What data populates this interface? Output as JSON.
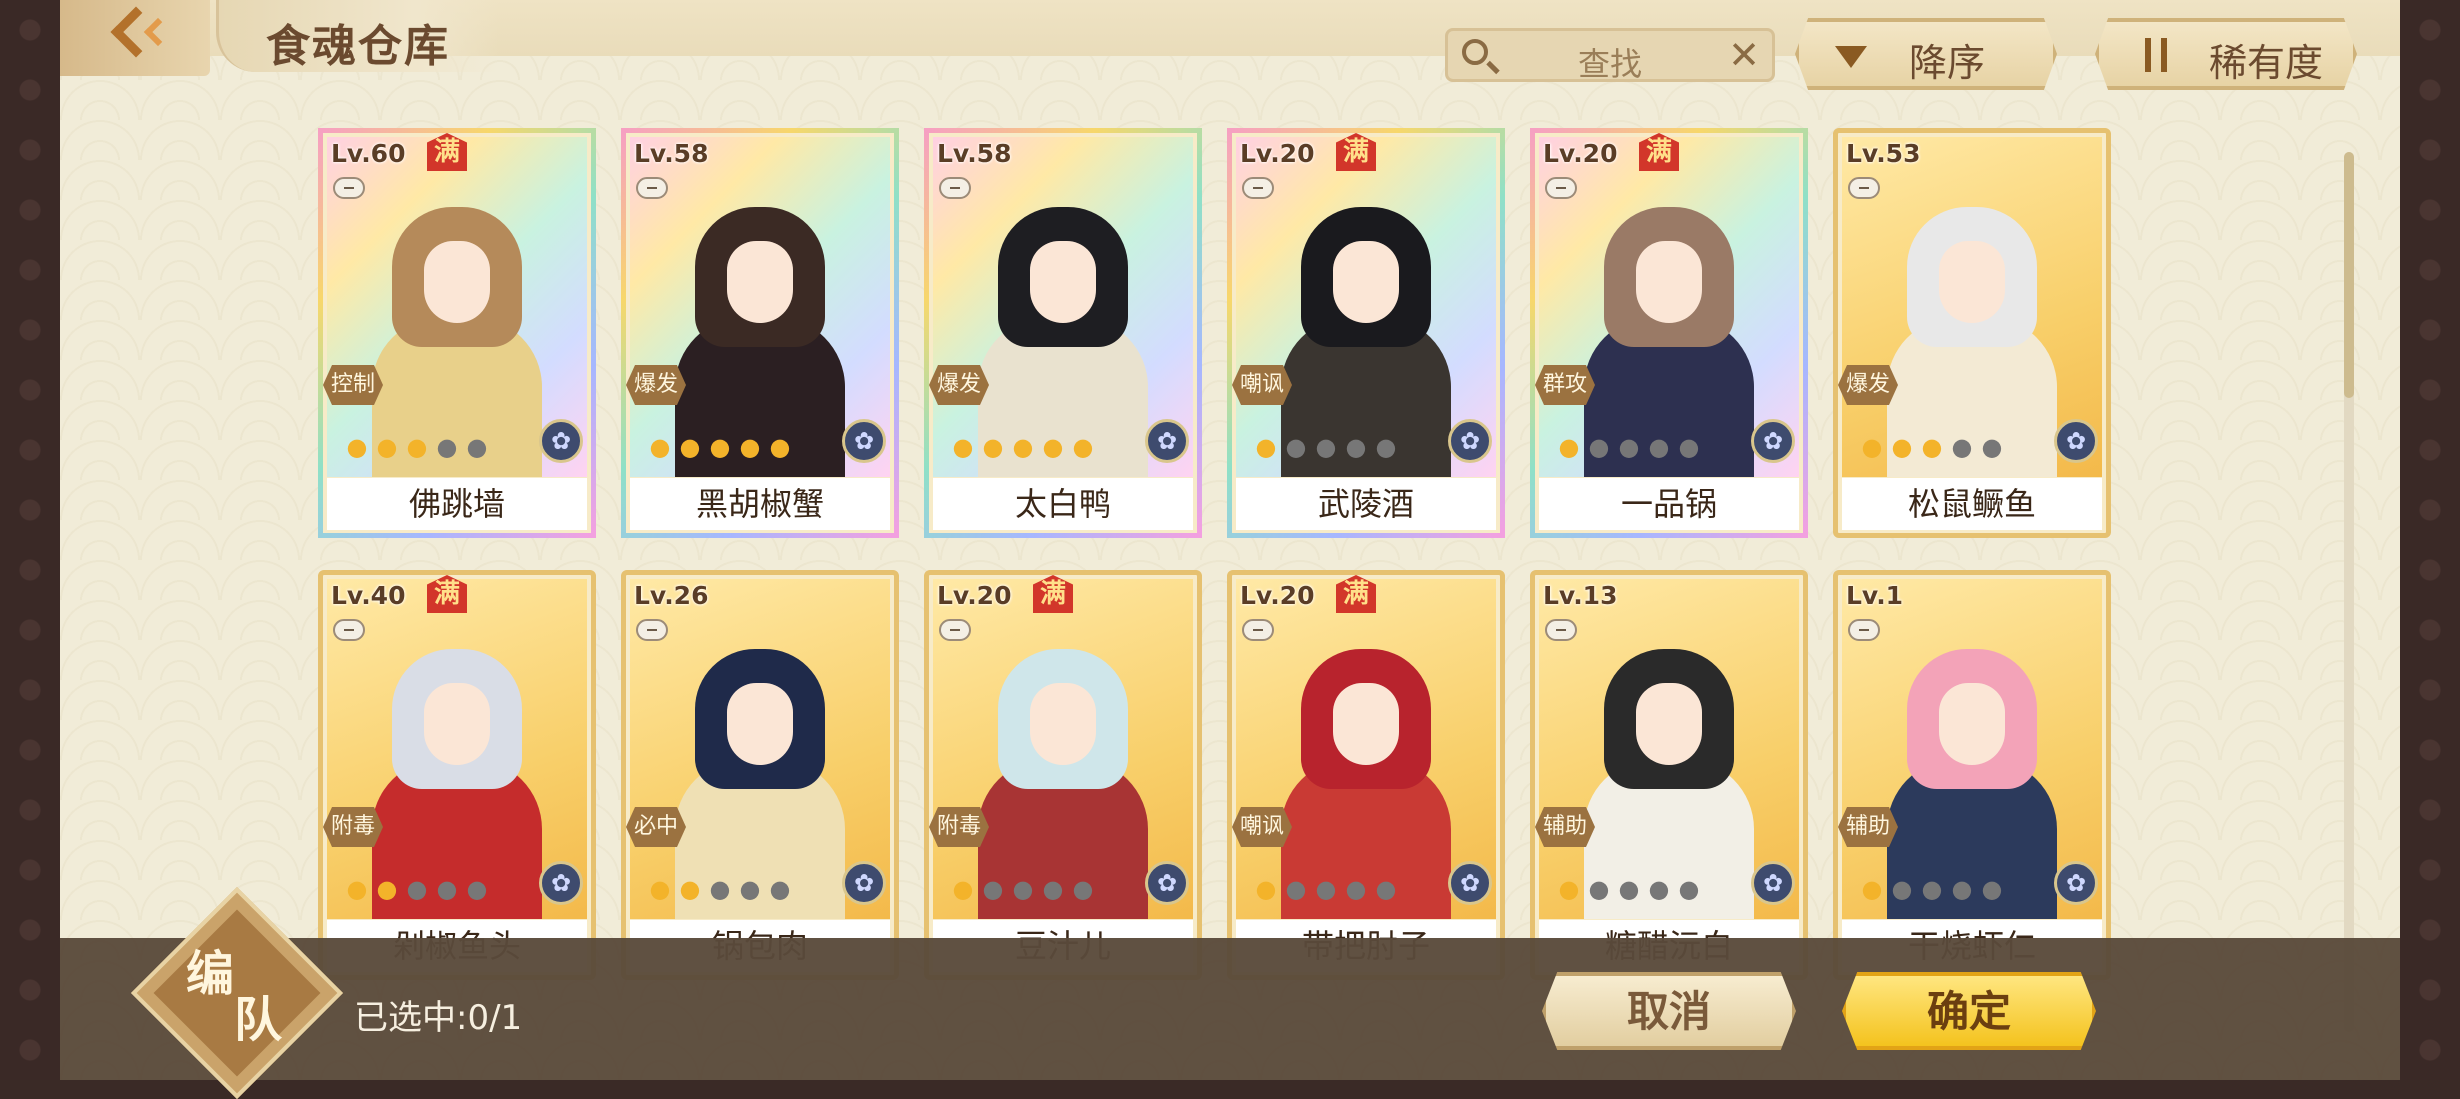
{
  "header": {
    "title": "食魂仓库",
    "search_placeholder": "查找",
    "sort_desc_label": "降序",
    "sort_rarity_label": "稀有度"
  },
  "colors": {
    "panel_bg": "#f1ecd8",
    "card_border_gold": "#e6c170",
    "confirm_yellow": "#f4c31e",
    "full_badge_red": "#d2362a"
  },
  "scroll": {
    "position_fraction": 0.0,
    "visible_fraction": 0.28
  },
  "cards": [
    {
      "level": "Lv.60",
      "full": "满",
      "role": "控制",
      "name": "佛跳墙",
      "stars": 3,
      "max_stars": 5,
      "frame": "rainbow",
      "hair": "#b58a5a",
      "body": "#e8d08a"
    },
    {
      "level": "Lv.58",
      "full": "",
      "role": "爆发",
      "name": "黑胡椒蟹",
      "stars": 5,
      "max_stars": 5,
      "frame": "rainbow",
      "hair": "#3b2a24",
      "body": "#2b1f22"
    },
    {
      "level": "Lv.58",
      "full": "",
      "role": "爆发",
      "name": "太白鸭",
      "stars": 5,
      "max_stars": 5,
      "frame": "rainbow",
      "hair": "#1e1e22",
      "body": "#e9e2cf"
    },
    {
      "level": "Lv.20",
      "full": "满",
      "role": "嘲讽",
      "name": "武陵酒",
      "stars": 1,
      "max_stars": 5,
      "frame": "rainbow",
      "hair": "#1a1a1e",
      "body": "#3a3530"
    },
    {
      "level": "Lv.20",
      "full": "满",
      "role": "群攻",
      "name": "一品锅",
      "stars": 1,
      "max_stars": 5,
      "frame": "rainbow",
      "hair": "#9a7a66",
      "body": "#2d3050"
    },
    {
      "level": "Lv.53",
      "full": "",
      "role": "爆发",
      "name": "松鼠鳜鱼",
      "stars": 3,
      "max_stars": 5,
      "frame": "gold",
      "hair": "#e8e8e8",
      "body": "#f3ead4"
    },
    {
      "level": "Lv.40",
      "full": "满",
      "role": "附毒",
      "name": "剁椒鱼头",
      "stars": 2,
      "max_stars": 5,
      "frame": "gold",
      "hair": "#d9dde6",
      "body": "#c52c2c"
    },
    {
      "level": "Lv.26",
      "full": "",
      "role": "必中",
      "name": "锅包肉",
      "stars": 2,
      "max_stars": 5,
      "frame": "gold",
      "hair": "#1f2a4a",
      "body": "#efe0b4"
    },
    {
      "level": "Lv.20",
      "full": "满",
      "role": "附毒",
      "name": "豆汁儿",
      "stars": 1,
      "max_stars": 5,
      "frame": "gold",
      "hair": "#cfe6ea",
      "body": "#a83434"
    },
    {
      "level": "Lv.20",
      "full": "满",
      "role": "嘲讽",
      "name": "带把肘子",
      "stars": 1,
      "max_stars": 5,
      "frame": "gold",
      "hair": "#b8232d",
      "body": "#c93a34"
    },
    {
      "level": "Lv.13",
      "full": "",
      "role": "辅助",
      "name": "糖醋沅白",
      "stars": 1,
      "max_stars": 5,
      "frame": "gold",
      "hair": "#2a2a2a",
      "body": "#f2efe6"
    },
    {
      "level": "Lv.1",
      "full": "",
      "role": "辅助",
      "name": "干烧虾仁",
      "stars": 1,
      "max_stars": 5,
      "frame": "gold",
      "hair": "#f3a3b8",
      "body": "#2c3a5c"
    }
  ],
  "footer": {
    "team_char1": "编",
    "team_char2": "队",
    "selected_text": "已选中:0/1",
    "cancel_label": "取消",
    "confirm_label": "确定"
  }
}
